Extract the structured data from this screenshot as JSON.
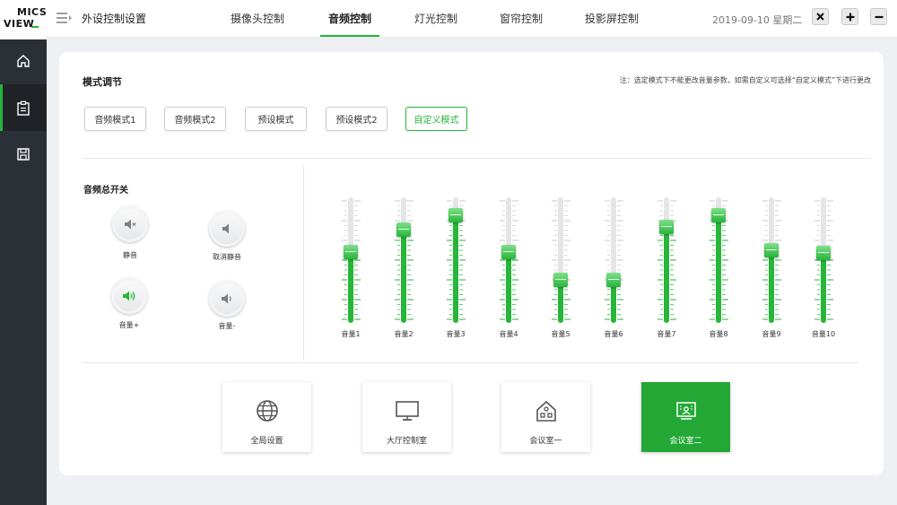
{
  "brand": {
    "line1": "MICS",
    "line2": "VIEW"
  },
  "sidebar": {
    "items": [
      {
        "icon": "home-icon",
        "active": false
      },
      {
        "icon": "clipboard-icon",
        "active": true
      },
      {
        "icon": "save-icon",
        "active": false
      }
    ]
  },
  "header": {
    "title": "外设控制设置",
    "tabs": [
      {
        "label": "摄像头控制",
        "active": false
      },
      {
        "label": "音频控制",
        "active": true
      },
      {
        "label": "灯光控制",
        "active": false
      },
      {
        "label": "窗帘控制",
        "active": false
      },
      {
        "label": "投影屏控制",
        "active": false
      }
    ],
    "date": "2019-09-10 星期二"
  },
  "mode": {
    "title": "模式调节",
    "note": "注：选定模式下不能更改音量参数，如需自定义可选择“自定义模式”下进行更改",
    "buttons": [
      {
        "label": "音频模式1",
        "active": false
      },
      {
        "label": "音频模式2",
        "active": false
      },
      {
        "label": "预设模式",
        "active": false
      },
      {
        "label": "预设模式2",
        "active": false
      },
      {
        "label": "自定义模式",
        "active": true
      }
    ]
  },
  "audio": {
    "title": "音频总开关",
    "controls": [
      {
        "label": "静音",
        "icon": "mute-icon",
        "active": false
      },
      {
        "label": "取消静音",
        "icon": "speaker-icon",
        "active": false
      },
      {
        "label": "音量+",
        "icon": "volume-up-icon",
        "active": true
      },
      {
        "label": "音量-",
        "icon": "volume-down-icon",
        "active": false
      }
    ]
  },
  "sliders": [
    {
      "label": "音量1",
      "level": 0.58
    },
    {
      "label": "音量2",
      "level": 0.76
    },
    {
      "label": "音量3",
      "level": 0.87
    },
    {
      "label": "音量4",
      "level": 0.58
    },
    {
      "label": "音量5",
      "level": 0.36
    },
    {
      "label": "音量6",
      "level": 0.36
    },
    {
      "label": "音量7",
      "level": 0.78
    },
    {
      "label": "音量8",
      "level": 0.87
    },
    {
      "label": "音量9",
      "level": 0.59
    },
    {
      "label": "音量10",
      "level": 0.57
    }
  ],
  "rooms": [
    {
      "label": "全局设置",
      "icon": "globe-icon",
      "active": false
    },
    {
      "label": "大厅控制室",
      "icon": "monitor-icon",
      "active": false
    },
    {
      "label": "会议室一",
      "icon": "house-icon",
      "active": false
    },
    {
      "label": "会议室二",
      "icon": "conference-icon",
      "active": true
    }
  ],
  "colors": {
    "accent": "#27b53a",
    "sidebar": "#2b3036",
    "background": "#eef0f3"
  }
}
